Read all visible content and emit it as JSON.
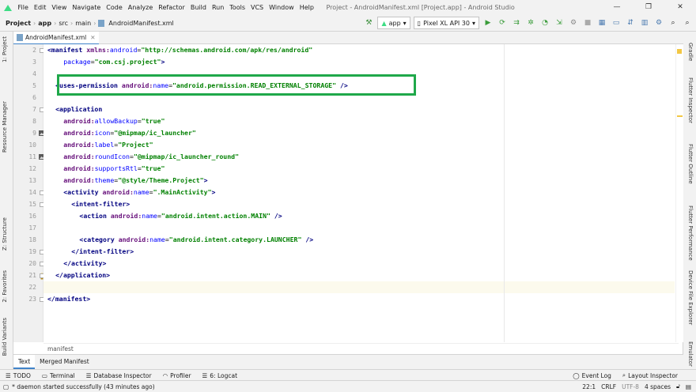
{
  "menubar": {
    "items": [
      "File",
      "Edit",
      "View",
      "Navigate",
      "Code",
      "Analyze",
      "Refactor",
      "Build",
      "Run",
      "Tools",
      "VCS",
      "Window",
      "Help"
    ],
    "window_title": "Project - AndroidManifest.xml [Project.app] - Android Studio",
    "controls": {
      "minimize": "—",
      "maximize": "❐",
      "close": "✕"
    }
  },
  "navbar": {
    "breadcrumbs": [
      "Project",
      "app",
      "src",
      "main",
      "AndroidManifest.xml"
    ],
    "run_config": "app",
    "device": "Pixel XL API 30"
  },
  "left_tools": [
    "1: Project",
    "Resource Manager",
    "Z: Structure",
    "2: Favorites",
    "Build Variants"
  ],
  "right_tools": [
    "Gradle",
    "Flutter Inspector",
    "Flutter Outline",
    "Flutter Performance",
    "Device File Explorer",
    "Emulator"
  ],
  "editor": {
    "tab_label": "AndroidManifest.xml",
    "lines": [
      {
        "n": "2",
        "indent": 0,
        "parts": [
          [
            "tag",
            "<manifest "
          ],
          [
            "attr",
            "xmlns:"
          ],
          [
            "aname",
            "android"
          ],
          [
            "punct",
            "="
          ],
          [
            "val",
            "\"http://schemas.android.com/apk/res/android\""
          ]
        ]
      },
      {
        "n": "3",
        "indent": 4,
        "parts": [
          [
            "aname",
            "package"
          ],
          [
            "punct",
            "="
          ],
          [
            "val",
            "\"com.csj.project\""
          ],
          [
            "tag",
            ">"
          ]
        ]
      },
      {
        "n": "4",
        "indent": 0,
        "parts": []
      },
      {
        "n": "5",
        "indent": 2,
        "parts": [
          [
            "tag",
            "<uses-permission "
          ],
          [
            "attr",
            "android:"
          ],
          [
            "aname",
            "name"
          ],
          [
            "punct",
            "="
          ],
          [
            "val",
            "\"android.permission.READ_EXTERNAL_STORAGE\""
          ],
          [
            "tag",
            " />"
          ]
        ]
      },
      {
        "n": "6",
        "indent": 0,
        "parts": []
      },
      {
        "n": "7",
        "indent": 2,
        "parts": [
          [
            "tag",
            "<application"
          ]
        ]
      },
      {
        "n": "8",
        "indent": 4,
        "parts": [
          [
            "attr",
            "android:"
          ],
          [
            "aname",
            "allowBackup"
          ],
          [
            "punct",
            "="
          ],
          [
            "val",
            "\"true\""
          ]
        ]
      },
      {
        "n": "9",
        "indent": 4,
        "parts": [
          [
            "attr",
            "android:"
          ],
          [
            "aname",
            "icon"
          ],
          [
            "punct",
            "="
          ],
          [
            "val",
            "\"@mipmap/ic_launcher\""
          ]
        ]
      },
      {
        "n": "10",
        "indent": 4,
        "parts": [
          [
            "attr",
            "android:"
          ],
          [
            "aname",
            "label"
          ],
          [
            "punct",
            "="
          ],
          [
            "val",
            "\"Project\""
          ]
        ]
      },
      {
        "n": "11",
        "indent": 4,
        "parts": [
          [
            "attr",
            "android:"
          ],
          [
            "aname",
            "roundIcon"
          ],
          [
            "punct",
            "="
          ],
          [
            "val",
            "\"@mipmap/ic_launcher_round\""
          ]
        ]
      },
      {
        "n": "12",
        "indent": 4,
        "parts": [
          [
            "attr",
            "android:"
          ],
          [
            "aname",
            "supportsRtl"
          ],
          [
            "punct",
            "="
          ],
          [
            "val",
            "\"true\""
          ]
        ]
      },
      {
        "n": "13",
        "indent": 4,
        "parts": [
          [
            "attr",
            "android:"
          ],
          [
            "aname",
            "theme"
          ],
          [
            "punct",
            "="
          ],
          [
            "val",
            "\"@style/Theme.Project\""
          ],
          [
            "tag",
            ">"
          ]
        ]
      },
      {
        "n": "14",
        "indent": 4,
        "parts": [
          [
            "tag",
            "<activity "
          ],
          [
            "attr",
            "android:"
          ],
          [
            "aname",
            "name"
          ],
          [
            "punct",
            "="
          ],
          [
            "val",
            "\".MainActivity\""
          ],
          [
            "tag",
            ">"
          ]
        ]
      },
      {
        "n": "15",
        "indent": 6,
        "parts": [
          [
            "tag",
            "<intent-filter>"
          ]
        ]
      },
      {
        "n": "16",
        "indent": 8,
        "parts": [
          [
            "tag",
            "<action "
          ],
          [
            "attr",
            "android:"
          ],
          [
            "aname",
            "name"
          ],
          [
            "punct",
            "="
          ],
          [
            "val",
            "\"android.intent.action.MAIN\""
          ],
          [
            "tag",
            " />"
          ]
        ]
      },
      {
        "n": "17",
        "indent": 0,
        "parts": []
      },
      {
        "n": "18",
        "indent": 8,
        "parts": [
          [
            "tag",
            "<category "
          ],
          [
            "attr",
            "android:"
          ],
          [
            "aname",
            "name"
          ],
          [
            "punct",
            "="
          ],
          [
            "val",
            "\"android.intent.category.LAUNCHER\""
          ],
          [
            "tag",
            " />"
          ]
        ]
      },
      {
        "n": "19",
        "indent": 6,
        "parts": [
          [
            "tag",
            "</intent-filter>"
          ]
        ]
      },
      {
        "n": "20",
        "indent": 4,
        "parts": [
          [
            "tag",
            "</activity>"
          ]
        ]
      },
      {
        "n": "21",
        "indent": 2,
        "parts": [
          [
            "tag",
            "</application>"
          ]
        ]
      },
      {
        "n": "22",
        "indent": 0,
        "parts": [],
        "current": true
      },
      {
        "n": "23",
        "indent": 0,
        "parts": [
          [
            "tag",
            "</manifest>"
          ]
        ]
      }
    ],
    "breadcrumb": "manifest"
  },
  "bottom_tabs": [
    "Text",
    "Merged Manifest"
  ],
  "tool_windows": [
    {
      "icon": "☰",
      "label": "TODO"
    },
    {
      "icon": "▭",
      "label": "Terminal"
    },
    {
      "icon": "☰",
      "label": "Database Inspector"
    },
    {
      "icon": "◠",
      "label": "Profiler"
    },
    {
      "icon": "☰",
      "label": "6: Logcat"
    }
  ],
  "tool_right": [
    "Event Log",
    "Layout Inspector"
  ],
  "status": {
    "message": "* daemon started successfully (43 minutes ago)",
    "position": "22:1",
    "line_sep": "CRLF",
    "encoding": "UTF-8",
    "indent": "4 spaces"
  },
  "colors": {
    "highlight": "#1fa84a",
    "tag": "#000080",
    "attr": "#660e7a",
    "value": "#008000"
  }
}
